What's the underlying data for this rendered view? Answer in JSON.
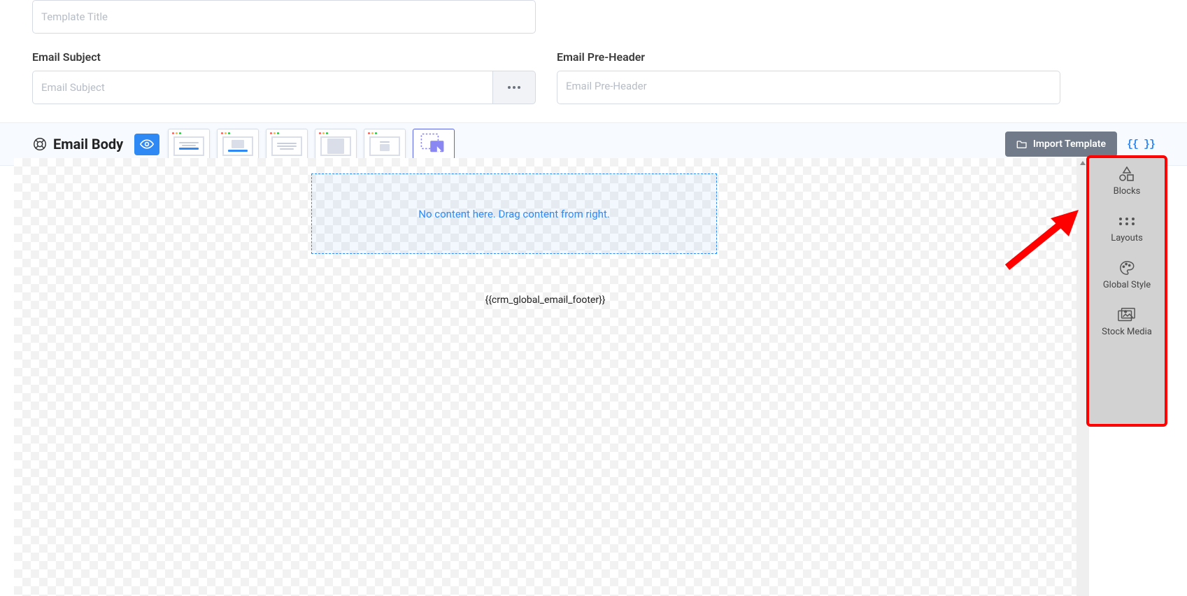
{
  "template_title": {
    "placeholder": "Template Title",
    "value": ""
  },
  "email_subject": {
    "label": "Email Subject",
    "placeholder": "Email Subject",
    "value": ""
  },
  "email_preheader": {
    "label": "Email Pre-Header",
    "placeholder": "Email Pre-Header",
    "value": ""
  },
  "email_body": {
    "label": "Email Body"
  },
  "import_button": "Import Template",
  "curly_token": "{{ }}",
  "canvas": {
    "drop_hint": "No content here. Drag content from right.",
    "footer_token": "{{crm_global_email_footer}}"
  },
  "side": {
    "blocks": "Blocks",
    "layouts": "Layouts",
    "global_style": "Global Style",
    "stock_media": "Stock Media"
  }
}
